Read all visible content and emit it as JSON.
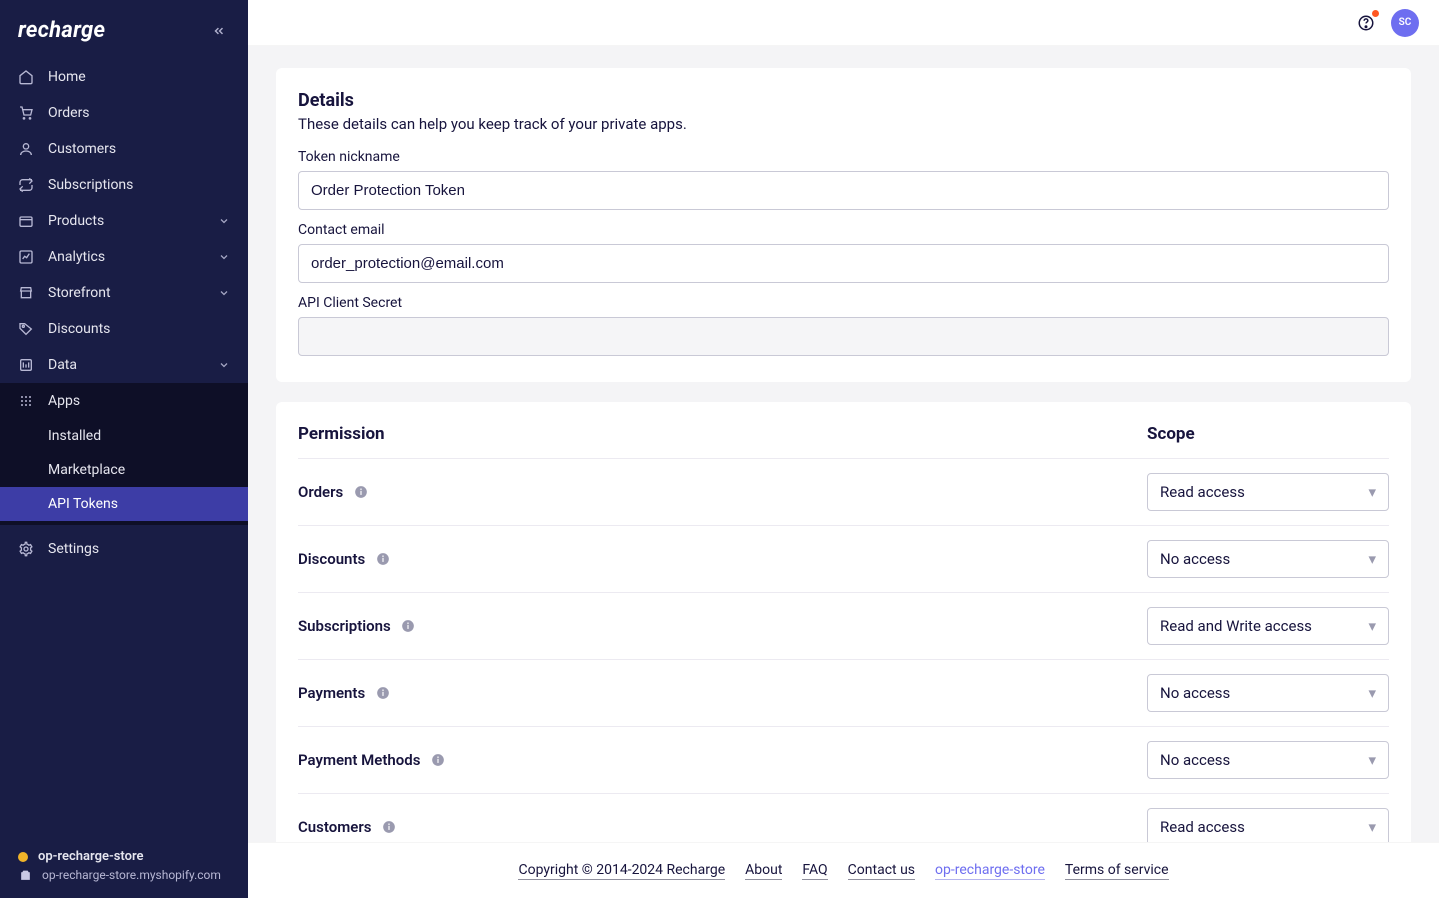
{
  "brand": "recharge",
  "sidebar": {
    "items": [
      {
        "label": "Home",
        "icon": "home"
      },
      {
        "label": "Orders",
        "icon": "cart"
      },
      {
        "label": "Customers",
        "icon": "user"
      },
      {
        "label": "Subscriptions",
        "icon": "loop"
      },
      {
        "label": "Products",
        "icon": "box",
        "expandable": true
      },
      {
        "label": "Analytics",
        "icon": "chart",
        "expandable": true
      },
      {
        "label": "Storefront",
        "icon": "store",
        "expandable": true
      },
      {
        "label": "Discounts",
        "icon": "tag"
      },
      {
        "label": "Data",
        "icon": "db",
        "expandable": true
      }
    ],
    "apps": {
      "label": "Apps",
      "children": [
        {
          "label": "Installed"
        },
        {
          "label": "Marketplace"
        },
        {
          "label": "API Tokens",
          "active": true
        }
      ]
    },
    "settings_label": "Settings",
    "footer": {
      "store_name": "op-recharge-store",
      "store_domain": "op-recharge-store.myshopify.com"
    }
  },
  "topbar": {
    "avatar_initials": "SC"
  },
  "details": {
    "heading": "Details",
    "sub": "These details can help you keep track of your private apps.",
    "token_nickname_label": "Token nickname",
    "token_nickname_value": "Order Protection Token",
    "contact_email_label": "Contact email",
    "contact_email_value": "order_protection@email.com",
    "api_secret_label": "API Client Secret",
    "api_secret_value": ""
  },
  "permissions": {
    "col_permission": "Permission",
    "col_scope": "Scope",
    "rows": [
      {
        "name": "Orders",
        "scope": "Read access"
      },
      {
        "name": "Discounts",
        "scope": "No access"
      },
      {
        "name": "Subscriptions",
        "scope": "Read and Write access"
      },
      {
        "name": "Payments",
        "scope": "No access"
      },
      {
        "name": "Payment Methods",
        "scope": "No access"
      },
      {
        "name": "Customers",
        "scope": "Read access"
      }
    ]
  },
  "footer": {
    "copyright": "Copyright © 2014-2024 Recharge",
    "about": "About",
    "faq": "FAQ",
    "contact": "Contact us",
    "store_link": "op-recharge-store",
    "tos": "Terms of service"
  }
}
